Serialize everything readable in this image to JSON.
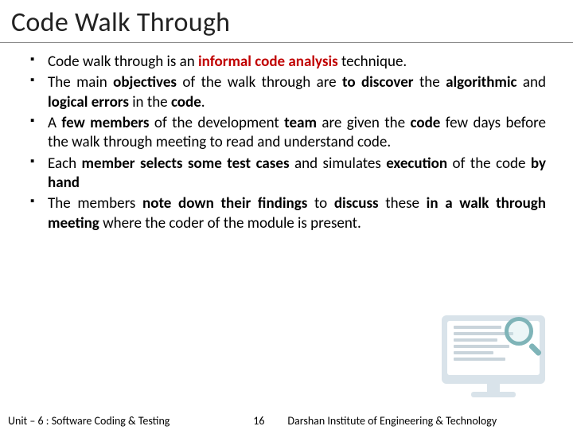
{
  "title": "Code Walk Through",
  "bullets": [
    {
      "justify": false,
      "runs": [
        {
          "t": "Code walk through is an "
        },
        {
          "t": "informal code analysis",
          "cls": "r"
        },
        {
          "t": " technique."
        }
      ]
    },
    {
      "justify": true,
      "runs": [
        {
          "t": "The main "
        },
        {
          "t": "objectives",
          "cls": "b"
        },
        {
          "t": " of the walk through are "
        },
        {
          "t": "to discover",
          "cls": "b"
        },
        {
          "t": " the "
        },
        {
          "t": "algorithmic",
          "cls": "b"
        },
        {
          "t": " and "
        },
        {
          "t": "logical errors",
          "cls": "b"
        },
        {
          "t": " in the "
        },
        {
          "t": "code",
          "cls": "b"
        },
        {
          "t": "."
        }
      ]
    },
    {
      "justify": true,
      "runs": [
        {
          "t": "A "
        },
        {
          "t": "few members",
          "cls": "b"
        },
        {
          "t": " of the development "
        },
        {
          "t": "team",
          "cls": "b"
        },
        {
          "t": " are given the "
        },
        {
          "t": "code",
          "cls": "b"
        },
        {
          "t": " few days before the walk through meeting to read and understand code."
        }
      ]
    },
    {
      "justify": true,
      "runs": [
        {
          "t": "Each "
        },
        {
          "t": "member selects some test cases",
          "cls": "b"
        },
        {
          "t": " and simulates "
        },
        {
          "t": "execution",
          "cls": "b"
        },
        {
          "t": " of the code "
        },
        {
          "t": "by hand",
          "cls": "b"
        }
      ]
    },
    {
      "justify": true,
      "runs": [
        {
          "t": "The members "
        },
        {
          "t": "note down their findings",
          "cls": "b"
        },
        {
          "t": " to "
        },
        {
          "t": "discuss",
          "cls": "b"
        },
        {
          "t": " these "
        },
        {
          "t": "in a walk through meeting",
          "cls": "b"
        },
        {
          "t": " where the coder of the module is present."
        }
      ]
    }
  ],
  "footer": {
    "left": "Unit – 6 : Software Coding & Testing",
    "page": "16",
    "right": "Darshan Institute of Engineering & Technology"
  }
}
